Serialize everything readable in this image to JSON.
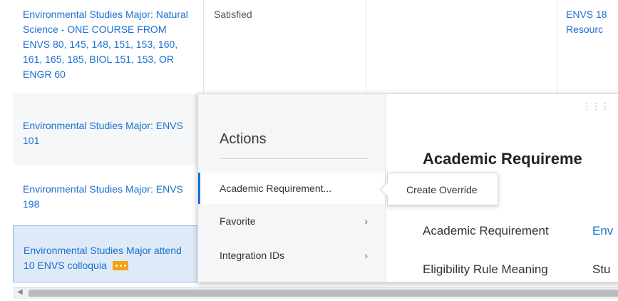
{
  "rows": [
    {
      "requirement": "Environmental Studies Major: Natural Science - ONE COURSE FROM ENVS 80, 145, 148, 151, 153, 160, 161, 165, 185, BIOL 151, 153, OR ENGR 60",
      "status": "Satisfied",
      "course": "ENVS 18",
      "course_sub": "Resourc"
    },
    {
      "requirement": "Environmental Studies Major: ENVS 101"
    },
    {
      "requirement": "Environmental Studies Major: ENVS 198"
    },
    {
      "requirement": "Environmental Studies Major attend 10 ENVS colloquia"
    }
  ],
  "actions_menu": {
    "title": "Actions",
    "items": [
      {
        "label": "Academic Requirement...",
        "active": true
      },
      {
        "label": "Favorite",
        "has_submenu": true
      },
      {
        "label": "Integration IDs",
        "has_submenu": true
      }
    ]
  },
  "submenu": {
    "item": "Create Override"
  },
  "detail": {
    "title": "Academic Requireme",
    "fields": [
      {
        "label": "Academic Requirement",
        "value": "Env"
      },
      {
        "label": "Eligibility Rule Meaning",
        "value": "Stu"
      }
    ]
  },
  "icons": {
    "related_actions": "ellipsis-icon",
    "submenu_chevron": "chevron-right-icon",
    "drag_handle": "drag-handle-icon",
    "scroll_left": "scroll-left-arrow-icon"
  },
  "colors": {
    "link": "#1a6fd1",
    "selected_row": "#dfeaf8",
    "related_actions_button": "#f2a30f"
  }
}
